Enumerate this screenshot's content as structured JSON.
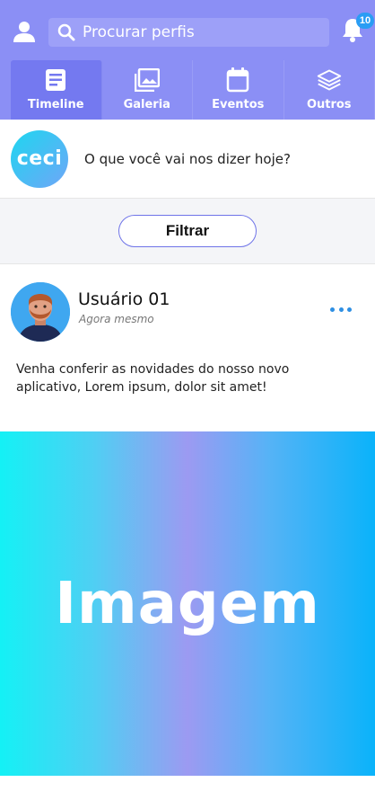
{
  "header": {
    "search_placeholder": "Procurar perfis",
    "notification_count": "10",
    "tabs": [
      {
        "label": "Timeline",
        "icon": "article-icon",
        "active": true
      },
      {
        "label": "Galeria",
        "icon": "gallery-icon",
        "active": false
      },
      {
        "label": "Eventos",
        "icon": "calendar-icon",
        "active": false
      },
      {
        "label": "Outros",
        "icon": "layers-icon",
        "active": false
      }
    ]
  },
  "composer": {
    "logo_text": "ceci",
    "prompt": "O que você vai nos dizer hoje?"
  },
  "filter": {
    "label": "Filtrar"
  },
  "post": {
    "user": "Usuário 01",
    "time": "Agora mesmo",
    "text": "Venha conferir as novidades do nosso novo aplicativo, Lorem ipsum, dolor sit amet!",
    "image_label": "Imagem"
  },
  "colors": {
    "header_bg": "#8B8FF5",
    "accent_blue": "#2A9DF4",
    "filter_border": "#6F74E8"
  }
}
